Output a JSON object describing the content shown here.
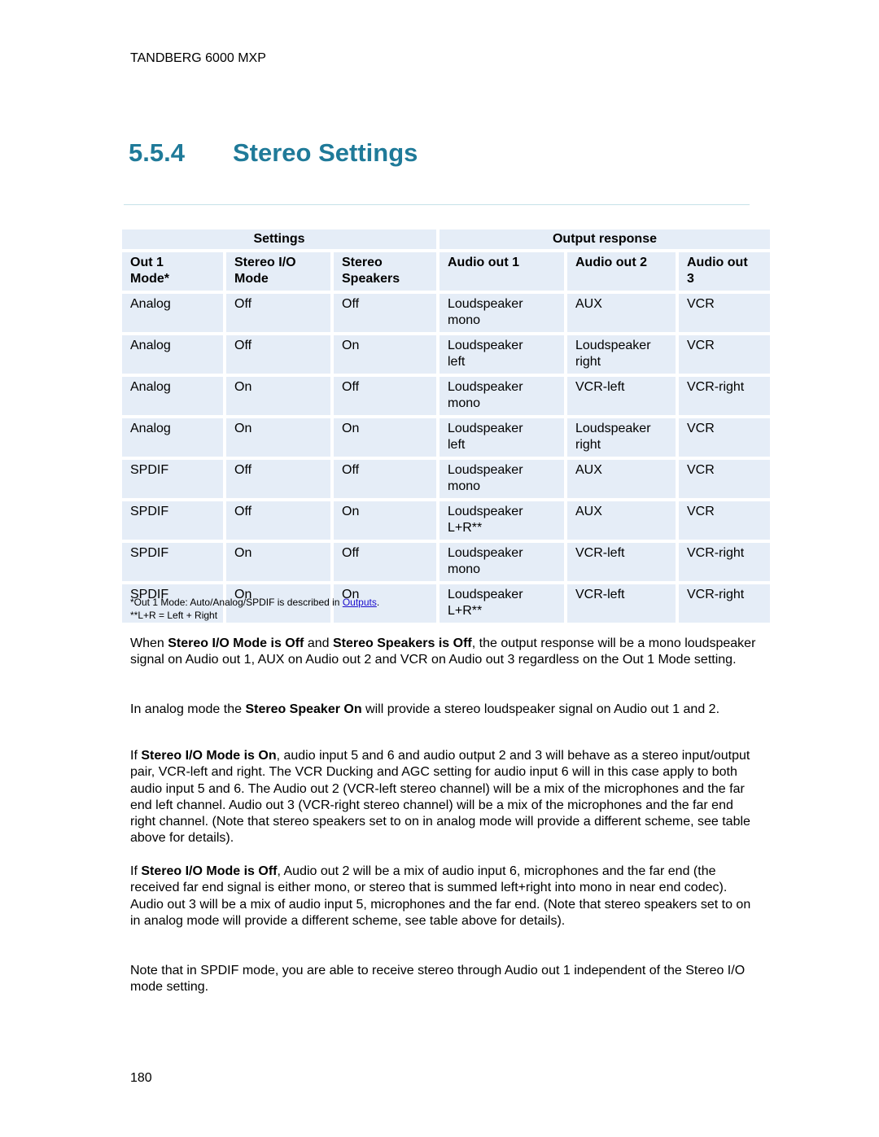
{
  "running_header": "TANDBERG 6000 MXP",
  "section": {
    "number": "5.5.4",
    "title": "Stereo Settings"
  },
  "colors": {
    "heading": "#1f7a99",
    "table_cell_bg": "#e5edf7",
    "link": "#1a0dcc",
    "rule": "#c6e1e8"
  },
  "table": {
    "groups": [
      "Settings",
      "Output response"
    ],
    "headers": [
      [
        "Out 1",
        "Mode*"
      ],
      [
        "Stereo I/O",
        "Mode"
      ],
      [
        "Stereo",
        "Speakers"
      ],
      [
        "Audio out 1",
        ""
      ],
      [
        "Audio out 2",
        ""
      ],
      [
        "Audio out",
        "3"
      ]
    ],
    "rows": [
      {
        "out1_mode": "Analog",
        "stereo_io": "Off",
        "stereo_speakers": "Off",
        "audio1": [
          "Loudspeaker",
          "mono"
        ],
        "audio2": [
          "AUX",
          ""
        ],
        "audio3": "VCR"
      },
      {
        "out1_mode": "Analog",
        "stereo_io": "Off",
        "stereo_speakers": "On",
        "audio1": [
          "Loudspeaker",
          "left"
        ],
        "audio2": [
          "Loudspeaker",
          "right"
        ],
        "audio3": "VCR"
      },
      {
        "out1_mode": "Analog",
        "stereo_io": "On",
        "stereo_speakers": "Off",
        "audio1": [
          "Loudspeaker",
          "mono"
        ],
        "audio2": [
          "VCR-left",
          ""
        ],
        "audio3": "VCR-right"
      },
      {
        "out1_mode": "Analog",
        "stereo_io": "On",
        "stereo_speakers": "On",
        "audio1": [
          "Loudspeaker",
          "left"
        ],
        "audio2": [
          "Loudspeaker",
          "right"
        ],
        "audio3": "VCR"
      },
      {
        "out1_mode": "SPDIF",
        "stereo_io": "Off",
        "stereo_speakers": "Off",
        "audio1": [
          "Loudspeaker",
          "mono"
        ],
        "audio2": [
          "AUX",
          ""
        ],
        "audio3": "VCR"
      },
      {
        "out1_mode": "SPDIF",
        "stereo_io": "Off",
        "stereo_speakers": "On",
        "audio1": [
          "Loudspeaker",
          "L+R**"
        ],
        "audio2": [
          "AUX",
          ""
        ],
        "audio3": "VCR"
      },
      {
        "out1_mode": "SPDIF",
        "stereo_io": "On",
        "stereo_speakers": "Off",
        "audio1": [
          "Loudspeaker",
          "mono"
        ],
        "audio2": [
          "VCR-left",
          ""
        ],
        "audio3": "VCR-right"
      },
      {
        "out1_mode": "SPDIF",
        "stereo_io": "On",
        "stereo_speakers": "On",
        "audio1": [
          "Loudspeaker",
          "L+R**"
        ],
        "audio2": [
          "VCR-left",
          ""
        ],
        "audio3": "VCR-right"
      }
    ]
  },
  "footnotes": {
    "note1_prefix": "*Out 1 Mode: Auto/Analog/SPDIF is described in ",
    "note1_link": "Outputs",
    "note1_suffix": ".",
    "note2": "**L+R = Left + Right"
  },
  "paragraphs": {
    "p1": {
      "t1": "When ",
      "b1": "Stereo I/O Mode is Off",
      "t2": " and ",
      "b2": "Stereo Speakers is Off",
      "t3": ", the output response will be a mono loudspeaker signal on Audio out 1, AUX on Audio out 2 and VCR on Audio out 3 regardless on the Out 1 Mode setting."
    },
    "p2": {
      "t1": "In analog mode the ",
      "b1": "Stereo Speaker On",
      "t2": " will provide a stereo loudspeaker signal on Audio out 1 and 2."
    },
    "p3": {
      "t1": "If ",
      "b1": "Stereo I/O Mode is On",
      "t2": ", audio input 5 and 6 and audio output 2 and 3 will behave as a stereo input/output pair, VCR-left and right. The VCR Ducking and AGC setting for audio input 6 will in this case apply to both audio input 5 and 6. The Audio out 2 (VCR-left stereo channel) will be a mix of the microphones and the far end left channel. Audio out 3 (VCR-right stereo channel) will be a mix of the microphones and the far end right channel. (Note that stereo speakers set to on in analog mode will provide a different scheme, see table above for details)."
    },
    "p4": {
      "t1": "If ",
      "b1": "Stereo I/O Mode is Off",
      "t2": ", Audio out 2 will be a mix of audio input 6, microphones and the far end (the received far end signal is either mono, or stereo that is summed left+right into mono in near end codec). Audio out 3 will be a mix of audio input 5, microphones and the far end. (Note that stereo speakers set to on in analog mode will provide a different scheme, see table above for details)."
    },
    "p5": {
      "t1": "Note that in SPDIF mode, you are able to receive stereo through Audio out 1 independent of the Stereo I/O mode setting."
    }
  },
  "page_number": "180"
}
